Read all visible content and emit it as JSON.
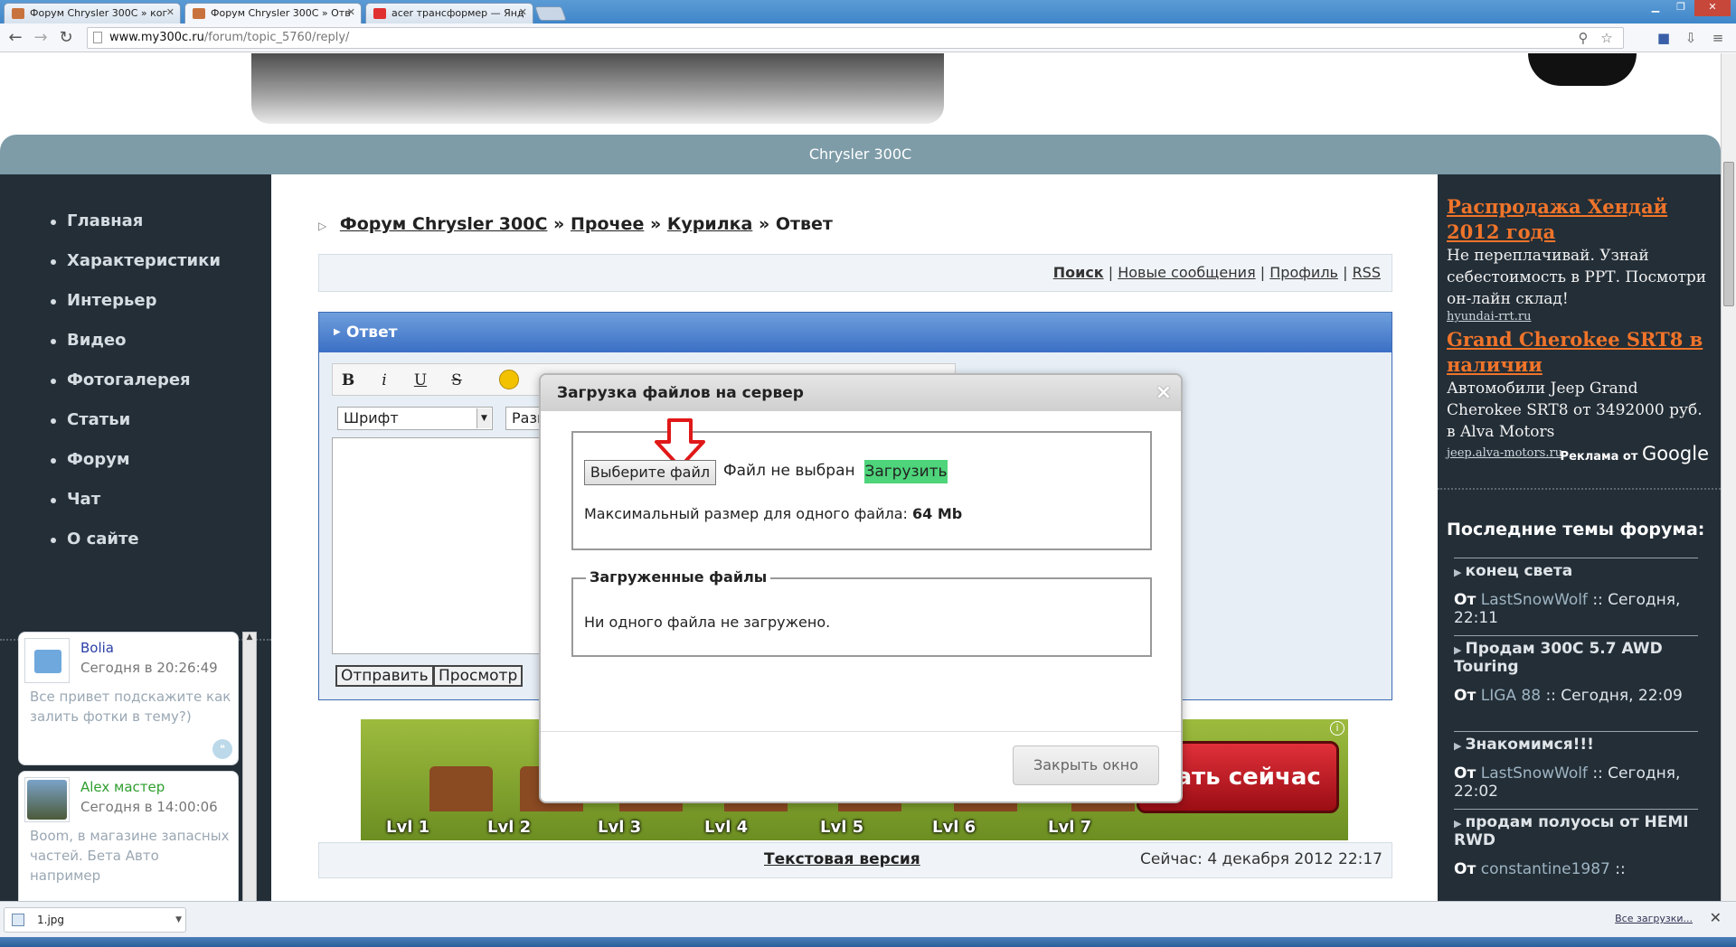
{
  "browser": {
    "tabs": [
      {
        "label": "Форум Chrysler 300С » ког"
      },
      {
        "label": "Форум Chrysler 300С » Отв"
      },
      {
        "label": "acer трансформер — Янд"
      }
    ],
    "url_host": "www.my300c.ru",
    "url_path": "/forum/topic_5760/reply/"
  },
  "site": {
    "title": "Chrysler 300C"
  },
  "leftnav": [
    "Главная",
    "Характеристики",
    "Интерьер",
    "Видео",
    "Фотогалерея",
    "Статьи",
    "Форум",
    "Чат",
    "О сайте"
  ],
  "chat": [
    {
      "nick": "Bolia",
      "nick_color": "#2a3fa8",
      "time": "Сегодня в 20:26:49",
      "text": "Все привет подскажите как залить фотки в тему?)"
    },
    {
      "nick": "Alex мастер",
      "nick_color": "#2e9e2e",
      "time": "Сегодня в 14:00:06",
      "text": "Boom, в магазине запасных частей. Бета Авто например"
    }
  ],
  "breadcrumb": {
    "items": [
      "Форум Chrysler 300C",
      "Прочее",
      "Курилка"
    ],
    "current": "Ответ",
    "sep": "»"
  },
  "links": {
    "search": "Поиск",
    "new": "Новые сообщения",
    "profile": "Профиль",
    "rss": "RSS",
    "sep": "|"
  },
  "reply": {
    "title": "Ответ",
    "font_select": "Шрифт",
    "size_select": "Разм",
    "tools": {
      "bold": "B",
      "italic": "i",
      "underline": "U",
      "strike": "S"
    },
    "send": "Отправить",
    "preview": "Просмотр"
  },
  "ad_game": {
    "levels": [
      "Lvl 1",
      "Lvl 2",
      "Lvl 3",
      "Lvl 4",
      "Lvl 5",
      "Lvl 6",
      "Lvl 7"
    ],
    "cta": "рать сейчас",
    "info": "i"
  },
  "footer": {
    "text_version": "Текстовая версия",
    "now": "Сейчас: 4 декабря 2012 22:17"
  },
  "adsense": [
    {
      "title": "Распродажа Хендай 2012 года",
      "desc": "Не переплачивай. Узнай себестоимость в РРТ. Посмотри он-лайн склад!",
      "url": "hyundai-rrt.ru"
    },
    {
      "title": "Grand Cherokee SRT8 в наличии",
      "desc": "Автомобили Jeep Grand Cherokee SRT8 от 3492000 руб. в Alva Motors",
      "url": "jeep.alva-motors.ru"
    }
  ],
  "adsense_by": "Реклама от",
  "adsense_brand": "Google",
  "topics_title": "Последние темы форума:",
  "topics": [
    {
      "title": "конец света",
      "from": "От",
      "user": "LastSnowWolf",
      "when": ":: Сегодня, 22:11"
    },
    {
      "title": "Продам 300С 5.7 AWD Touring",
      "from": "От",
      "user": "LIGA 88",
      "when": ":: Сегодня, 22:09"
    },
    {
      "title": "Знакомимся!!!",
      "from": "От",
      "user": "LastSnowWolf",
      "when": ":: Сегодня, 22:02"
    },
    {
      "title": "продам полуосы от HEMI RWD",
      "from": "От",
      "user": "constantine1987",
      "when": "::"
    }
  ],
  "modal": {
    "title": "Загрузка файлов на сервер",
    "close": "×",
    "choose_file": "Выберите файл",
    "no_file": "Файл не выбран",
    "upload": "Загрузить",
    "max_label": "Максимальный размер для одного файла:",
    "max_value": "64 Mb",
    "uploaded_legend": "Загруженные файлы",
    "uploaded_empty": "Ни одного файла не загружено.",
    "close_window": "Закрыть окно"
  },
  "downloads": {
    "file": "1.jpg",
    "all": "Все загрузки...",
    "close": "✕"
  }
}
